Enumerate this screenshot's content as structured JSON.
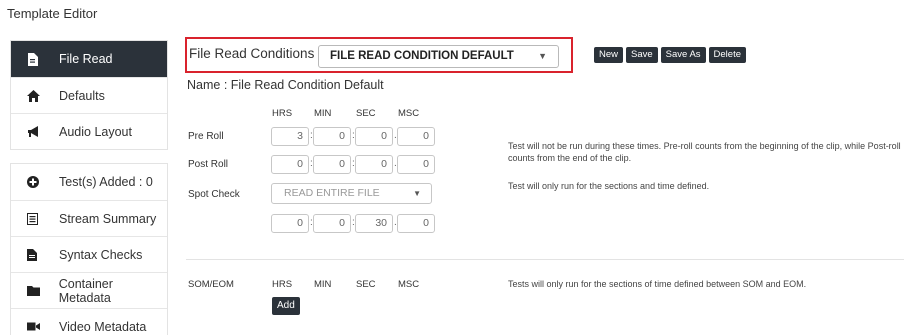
{
  "page_title": "Template Editor",
  "sidebar": {
    "group1": [
      {
        "label": "File Read",
        "icon": "file-icon",
        "active": true
      },
      {
        "label": "Defaults",
        "icon": "home-icon",
        "active": false
      },
      {
        "label": "Audio Layout",
        "icon": "megaphone-icon",
        "active": false
      }
    ],
    "group2": [
      {
        "label": "Test(s) Added : 0",
        "icon": "plus-circle-icon"
      },
      {
        "label": "Stream Summary",
        "icon": "list-icon"
      },
      {
        "label": "Syntax Checks",
        "icon": "document-icon"
      },
      {
        "label": "Container Metadata",
        "icon": "folder-icon"
      },
      {
        "label": "Video Metadata",
        "icon": "video-camera-icon"
      }
    ]
  },
  "conditions": {
    "label": "File Read Conditions",
    "selected": "FILE READ CONDITION DEFAULT"
  },
  "buttons": {
    "new": "New",
    "save": "Save",
    "save_as": "Save As",
    "delete": "Delete",
    "add": "Add"
  },
  "name_line": "Name : File Read Condition Default",
  "columns": [
    "HRS",
    "MIN",
    "SEC",
    "MSC"
  ],
  "rows": {
    "pre_roll": {
      "label": "Pre Roll",
      "values": [
        "3",
        "0",
        "0",
        "0"
      ]
    },
    "post_roll": {
      "label": "Post Roll",
      "values": [
        "0",
        "0",
        "0",
        "0"
      ]
    },
    "spot_check": {
      "label": "Spot Check",
      "mode": "READ ENTIRE FILE",
      "values": [
        "0",
        "0",
        "30",
        "0"
      ]
    }
  },
  "notes": {
    "roll": "Test will not be run during these times. Pre-roll counts from the beginning of the clip, while Post-roll counts from the end of the clip.",
    "spot": "Test will only run for the sections and time defined.",
    "som_eom": "Tests will only run for the sections of time defined between SOM and EOM."
  },
  "som_eom": {
    "label": "SOM/EOM",
    "columns": [
      "HRS",
      "MIN",
      "SEC",
      "MSC"
    ]
  },
  "colors": {
    "accent_dark": "#2b323a",
    "highlight_border": "#d9232d"
  }
}
